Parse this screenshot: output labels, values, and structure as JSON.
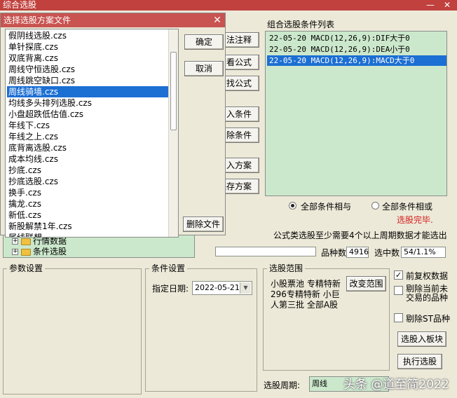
{
  "app": {
    "title": "综合选股",
    "minimize": "—",
    "close": "✕"
  },
  "dialog": {
    "title": "选择选股方案文件",
    "close": "✕",
    "files": [
      "假阴线选股.czs",
      "单针探底.czs",
      "双底背离.czs",
      "周线守恒选股.czs",
      "周线跳空缺口.czs",
      "周线骑墙.czs",
      "均线多头排列选股.czs",
      "小盘超跌低估值.czs",
      "年线下.czs",
      "年线之上.czs",
      "底背离选股.czs",
      "成本均线.czs",
      "抄底.czs",
      "抄底选股.czs",
      "换手.czs",
      "擒龙.czs",
      "新低.czs",
      "新股解禁1年.czs",
      "尾线联想"
    ],
    "selected_index": 5,
    "ok_label": "确定",
    "cancel_label": "取消",
    "delete_label": "删除文件"
  },
  "left_buttons": [
    "用法注释",
    "查看公式",
    "查找公式",
    "加入条件",
    "删除条件",
    "引入方案",
    "保存方案"
  ],
  "tree": [
    {
      "label": "行情数据",
      "expander": "+"
    },
    {
      "label": "条件选股",
      "expander": "+"
    }
  ],
  "conditions": {
    "title": "组合选股条件列表",
    "items": [
      "22-05-20 MACD(12,26,9):DIF大于0",
      "22-05-20 MACD(12,26,9):DEA小于0",
      "22-05-20 MACD(12,26,9):MACD大于0"
    ],
    "selected_index": 2
  },
  "logic": {
    "and_label": "全部条件相与",
    "or_label": "全部条件相或",
    "selected": "and"
  },
  "status": {
    "done": "选股完毕.",
    "note": "公式类选股至少需要4个以上周期数据才能选出",
    "count_label": "品种数",
    "count_value": "4916",
    "selected_label": "选中数",
    "selected_value": "54/1.1%"
  },
  "params": {
    "title": "参数设置"
  },
  "cond_settings": {
    "title": "条件设置",
    "date_label": "指定日期:",
    "date_value": "2022-05-21"
  },
  "range": {
    "title": "选股范围",
    "text": "小股票池 专精特新 296专精特新 小巨人第三批 全部A股",
    "change_label": "改变范围"
  },
  "options": {
    "pre_adjust_label": "前复权数据",
    "pre_adjust_checked": true,
    "exclude_delisted_label": "剔除当前未交易的品种",
    "exclude_delisted_checked": false,
    "exclude_st_label": "剔除ST品种",
    "exclude_st_checked": false
  },
  "actions": {
    "to_block_label": "选股入板块",
    "run_label": "执行选股"
  },
  "period": {
    "label": "选股周期:",
    "value": "周线"
  },
  "watermark": "头条 @道至简2022"
}
